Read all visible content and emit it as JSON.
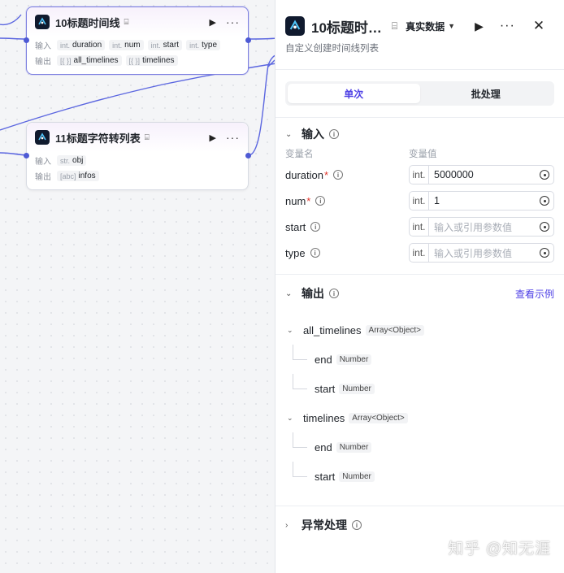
{
  "canvas": {
    "node1": {
      "title": "10标题时间线",
      "input_label": "输入",
      "output_label": "输出",
      "inputs": [
        {
          "type": "int.",
          "name": "duration"
        },
        {
          "type": "int.",
          "name": "num"
        },
        {
          "type": "int.",
          "name": "start"
        },
        {
          "type": "int.",
          "name": "type"
        }
      ],
      "outputs": [
        {
          "type": "[{ }]",
          "name": "all_timelines"
        },
        {
          "type": "[{ }]",
          "name": "timelines"
        }
      ]
    },
    "node2": {
      "title": "11标题字符转列表",
      "input_label": "输入",
      "output_label": "输出",
      "inputs": [
        {
          "type": "str.",
          "name": "obj"
        }
      ],
      "outputs": [
        {
          "type": "[abc]",
          "name": "infos"
        }
      ]
    },
    "wire_color": "#5b66e0"
  },
  "panel": {
    "title": "10标题时…",
    "mode": "真实数据",
    "description": "自定义创建时间线列表",
    "tabs": [
      {
        "label": "单次",
        "active": true
      },
      {
        "label": "批处理",
        "active": false
      }
    ],
    "input_section": {
      "title": "输入",
      "col_name": "变量名",
      "col_value": "变量值",
      "params": [
        {
          "name": "duration",
          "required": "*",
          "type": "int.",
          "value": "5000000",
          "placeholder": ""
        },
        {
          "name": "num",
          "required": "*",
          "type": "int.",
          "value": "1",
          "placeholder": ""
        },
        {
          "name": "start",
          "required": "",
          "type": "int.",
          "value": "",
          "placeholder": "输入或引用参数值"
        },
        {
          "name": "type",
          "required": "",
          "type": "int.",
          "value": "",
          "placeholder": "输入或引用参数值"
        }
      ]
    },
    "output_section": {
      "title": "输出",
      "link": "查看示例",
      "fields": [
        {
          "name": "all_timelines",
          "type": "Array<Object>",
          "children": [
            {
              "name": "end",
              "type": "Number"
            },
            {
              "name": "start",
              "type": "Number"
            }
          ]
        },
        {
          "name": "timelines",
          "type": "Array<Object>",
          "children": [
            {
              "name": "end",
              "type": "Number"
            },
            {
              "name": "start",
              "type": "Number"
            }
          ]
        }
      ]
    },
    "error_section": {
      "title": "异常处理"
    }
  },
  "watermark": "知乎 @知无涯",
  "colors": {
    "accent": "#4e40e5",
    "required": "#e0352b",
    "wire": "#5b66e0"
  }
}
